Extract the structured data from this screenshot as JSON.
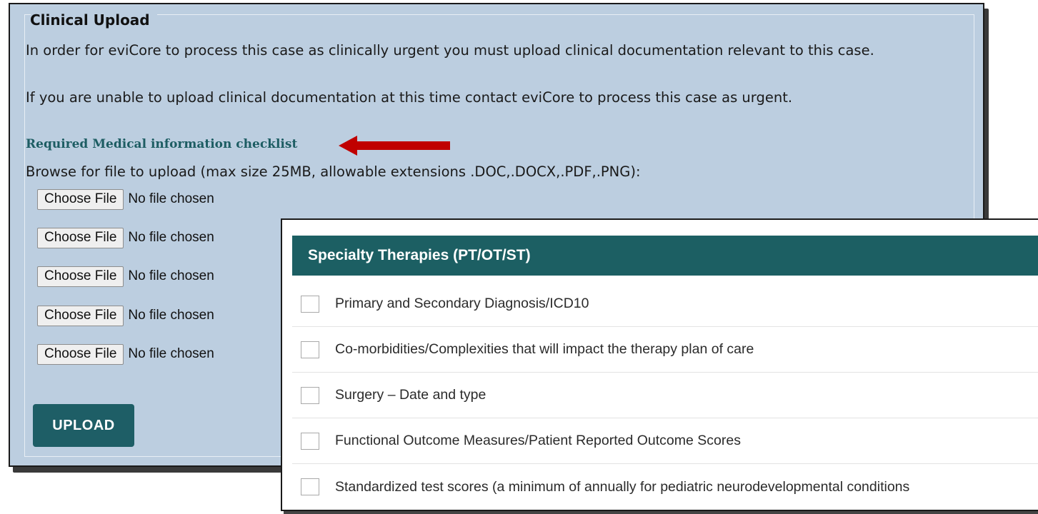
{
  "clinical_upload": {
    "title": "Clinical Upload",
    "paragraph1": "In order for eviCore to process this case as clinically urgent you must upload clinical documentation relevant to this case.",
    "paragraph2": "If you are unable to upload clinical documentation at this time contact eviCore to process this case as urgent.",
    "checklist_link": "Required Medical information checklist",
    "browse_text": "Browse for file to upload (max size 25MB, allowable extensions .DOC,.DOCX,.PDF,.PNG):",
    "file_inputs": [
      {
        "button": "Choose File",
        "status": "No file chosen"
      },
      {
        "button": "Choose File",
        "status": "No file chosen"
      },
      {
        "button": "Choose File",
        "status": "No file chosen"
      },
      {
        "button": "Choose File",
        "status": "No file chosen"
      },
      {
        "button": "Choose File",
        "status": "No file chosen"
      }
    ],
    "upload_button": "UPLOAD"
  },
  "checklist": {
    "header": "Specialty Therapies (PT/OT/ST)",
    "items": [
      {
        "label": "Primary and Secondary Diagnosis/ICD10",
        "checked": false
      },
      {
        "label": "Co-morbidities/Complexities that will impact the therapy plan of care",
        "checked": false
      },
      {
        "label": "Surgery – Date and type",
        "checked": false
      },
      {
        "label": "Functional Outcome Measures/Patient Reported Outcome Scores",
        "checked": false
      },
      {
        "label": "Standardized test scores (a minimum of annually for pediatric neurodevelopmental conditions",
        "checked": false
      }
    ]
  },
  "colors": {
    "panel_bg": "#bccee0",
    "teal": "#1e5e66",
    "link": "#1d5d63",
    "arrow": "#c00000"
  },
  "icons": {
    "annotation_arrow": "red-left-arrow"
  }
}
